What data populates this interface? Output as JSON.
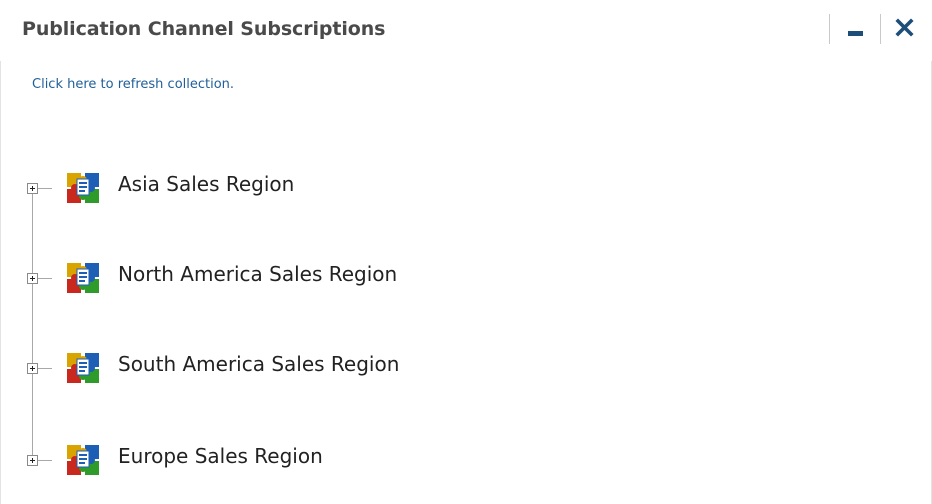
{
  "portlet": {
    "title": "Publication Channel Subscriptions",
    "refresh_link": "Click here to refresh collection.",
    "controls": {
      "minimize_icon": "minimize-icon",
      "close_icon": "close-icon"
    }
  },
  "tree": {
    "items": [
      {
        "label": "Asia Sales Region",
        "icon": "publication-channel-icon"
      },
      {
        "label": "North America Sales Region",
        "icon": "publication-channel-icon"
      },
      {
        "label": "South America Sales Region",
        "icon": "publication-channel-icon"
      },
      {
        "label": "Europe Sales Region",
        "icon": "publication-channel-icon"
      }
    ]
  },
  "colors": {
    "title_text": "#4a4a4a",
    "link": "#1f5f99",
    "control_icon": "#1d4e7a",
    "tree_line": "#a8a8a8"
  }
}
